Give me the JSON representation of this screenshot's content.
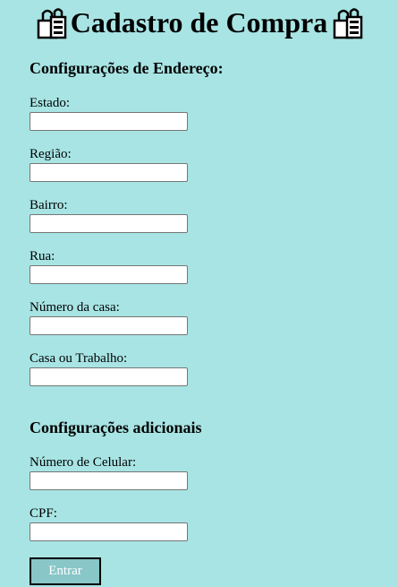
{
  "header": {
    "title": "Cadastro de Compra",
    "left_icon": "shopping-bags-icon",
    "right_icon": "shopping-bags-icon"
  },
  "address_section": {
    "title": "Configurações de Endereço:",
    "fields": [
      {
        "label": "Estado:",
        "value": ""
      },
      {
        "label": "Região:",
        "value": ""
      },
      {
        "label": "Bairro:",
        "value": ""
      },
      {
        "label": "Rua:",
        "value": ""
      },
      {
        "label": "Número da casa:",
        "value": ""
      },
      {
        "label": "Casa ou Trabalho:",
        "value": ""
      }
    ]
  },
  "extra_section": {
    "title": "Configurações adicionais",
    "fields": [
      {
        "label": "Número de Celular:",
        "value": ""
      },
      {
        "label": "CPF:",
        "value": ""
      }
    ]
  },
  "submit": {
    "label": "Entrar"
  },
  "colors": {
    "background": "#a8e4e4",
    "button_background": "#88c6c8",
    "button_text": "#ffffff"
  }
}
